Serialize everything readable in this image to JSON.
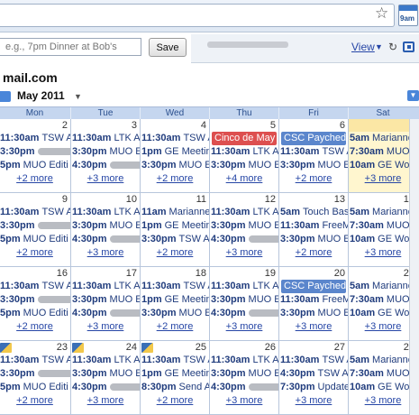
{
  "browser": {
    "extension_badge": "9am"
  },
  "popup": {
    "quick_add_placeholder": "e.g., 7pm Dinner at Bob's",
    "save_label": "Save",
    "view_label": "View",
    "account": "mail.com",
    "month_title": "May 2011"
  },
  "weekdays": [
    "Mon",
    "Tue",
    "Wed",
    "Thu",
    "Fri",
    "Sat"
  ],
  "weeks": [
    [
      {
        "num": "2",
        "events": [
          {
            "t": "11:30am",
            "x": "TSW A"
          },
          {
            "t": "3:30pm",
            "blur": true
          },
          {
            "t": "5pm",
            "x": "MUO Editi"
          }
        ],
        "more": "+2 more"
      },
      {
        "num": "3",
        "events": [
          {
            "t": "11:30am",
            "x": "LTK A"
          },
          {
            "t": "3:30pm",
            "x": "MUO Ec"
          },
          {
            "t": "4:30pm",
            "blur": true
          }
        ],
        "more": "+3 more"
      },
      {
        "num": "4",
        "events": [
          {
            "t": "11:30am",
            "x": "TSW A"
          },
          {
            "t": "1pm",
            "x": "GE Meetin"
          },
          {
            "t": "3:30pm",
            "x": "MUO Ec"
          }
        ],
        "more": "+2 more"
      },
      {
        "num": "5",
        "events": [
          {
            "allday": "red",
            "x": "Cinco de May"
          },
          {
            "t": "11:30am",
            "x": "LTK A"
          },
          {
            "t": "3:30pm",
            "x": "MUO Ec"
          }
        ],
        "more": "+4 more"
      },
      {
        "num": "6",
        "events": [
          {
            "allday": "blue",
            "x": "CSC Payched"
          },
          {
            "t": "11:30am",
            "x": "TSW A"
          },
          {
            "t": "3:30pm",
            "x": "MUO Ec"
          }
        ],
        "more": "+2 more"
      },
      {
        "num": "7",
        "today": true,
        "events": [
          {
            "t": "5am",
            "x": "Marianne"
          },
          {
            "t": "7:30am",
            "x": "MUO An"
          },
          {
            "t": "10am",
            "x": "GE Work"
          }
        ],
        "more": "+3 more"
      }
    ],
    [
      {
        "num": "9",
        "events": [
          {
            "t": "11:30am",
            "x": "TSW A"
          },
          {
            "t": "3:30pm",
            "blur": true
          },
          {
            "t": "5pm",
            "x": "MUO Editi"
          }
        ],
        "more": "+2 more"
      },
      {
        "num": "10",
        "events": [
          {
            "t": "11:30am",
            "x": "LTK A"
          },
          {
            "t": "3:30pm",
            "x": "MUO Ec"
          },
          {
            "t": "4:30pm",
            "blur": true
          }
        ],
        "more": "+3 more"
      },
      {
        "num": "11",
        "events": [
          {
            "t": "11am",
            "x": "Marianne"
          },
          {
            "t": "1pm",
            "x": "GE Meetin"
          },
          {
            "t": "3:30pm",
            "x": "TSW A"
          }
        ],
        "more": "+2 more"
      },
      {
        "num": "12",
        "events": [
          {
            "t": "11:30am",
            "x": "LTK A"
          },
          {
            "t": "3:30pm",
            "x": "MUO Ec"
          },
          {
            "t": "4:30pm",
            "blur": true
          }
        ],
        "more": "+3 more"
      },
      {
        "num": "13",
        "events": [
          {
            "t": "5am",
            "x": "Touch Bas"
          },
          {
            "t": "11:30am",
            "x": "FreeM"
          },
          {
            "t": "3:30pm",
            "x": "MUO Ec"
          }
        ],
        "more": "+2 more"
      },
      {
        "num": "14",
        "events": [
          {
            "t": "5am",
            "x": "Marianne"
          },
          {
            "t": "7:30am",
            "x": "MUO An"
          },
          {
            "t": "10am",
            "x": "GE Work"
          }
        ],
        "more": "+3 more"
      }
    ],
    [
      {
        "num": "16",
        "events": [
          {
            "t": "11:30am",
            "x": "TSW A"
          },
          {
            "t": "3:30pm",
            "blur": true
          },
          {
            "t": "5pm",
            "x": "MUO Editi"
          }
        ],
        "more": "+2 more"
      },
      {
        "num": "17",
        "events": [
          {
            "t": "11:30am",
            "x": "LTK A"
          },
          {
            "t": "3:30pm",
            "x": "MUO Ec"
          },
          {
            "t": "4:30pm",
            "blur": true
          }
        ],
        "more": "+3 more"
      },
      {
        "num": "18",
        "events": [
          {
            "t": "11:30am",
            "x": "TSW A"
          },
          {
            "t": "1pm",
            "x": "GE Meetin"
          },
          {
            "t": "3:30pm",
            "x": "MUO Ec"
          }
        ],
        "more": "+2 more"
      },
      {
        "num": "19",
        "events": [
          {
            "t": "11:30am",
            "x": "LTK A"
          },
          {
            "t": "3:30pm",
            "x": "MUO Ec"
          },
          {
            "t": "4:30pm",
            "blur": true
          }
        ],
        "more": "+3 more"
      },
      {
        "num": "20",
        "events": [
          {
            "allday": "blue",
            "x": "CSC Payched"
          },
          {
            "t": "11:30am",
            "x": "FreeM"
          },
          {
            "t": "3:30pm",
            "x": "MUO Ec"
          }
        ],
        "more": "+3 more"
      },
      {
        "num": "21",
        "events": [
          {
            "t": "5am",
            "x": "Marianne"
          },
          {
            "t": "7:30am",
            "x": "MUO An"
          },
          {
            "t": "10am",
            "x": "GE Work"
          }
        ],
        "more": "+3 more"
      }
    ],
    [
      {
        "num": "23",
        "icon": true,
        "events": [
          {
            "t": "11:30am",
            "x": "TSW A"
          },
          {
            "t": "3:30pm",
            "blur": true
          },
          {
            "t": "5pm",
            "x": "MUO Editi"
          }
        ],
        "more": "+2 more"
      },
      {
        "num": "24",
        "icon": true,
        "events": [
          {
            "t": "11:30am",
            "x": "LTK A"
          },
          {
            "t": "3:30pm",
            "x": "MUO Ec"
          },
          {
            "t": "4:30pm",
            "blur": true
          }
        ],
        "more": "+3 more"
      },
      {
        "num": "25",
        "icon": true,
        "events": [
          {
            "t": "11:30am",
            "x": "TSW A"
          },
          {
            "t": "1pm",
            "x": "GE Meetin"
          },
          {
            "t": "8:30pm",
            "x": "Send Ann"
          }
        ],
        "more": "+2 more"
      },
      {
        "num": "26",
        "events": [
          {
            "t": "11:30am",
            "x": "LTK A"
          },
          {
            "t": "3:30pm",
            "x": "MUO Ec"
          },
          {
            "t": "4:30pm",
            "blur": true
          }
        ],
        "more": "+3 more"
      },
      {
        "num": "27",
        "events": [
          {
            "t": "11:30am",
            "x": "TSW A"
          },
          {
            "t": "4:30pm",
            "x": "TSW A"
          },
          {
            "t": "7:30pm",
            "x": "Update"
          }
        ],
        "more": "+3 more"
      },
      {
        "num": "28",
        "events": [
          {
            "t": "5am",
            "x": "Marianne"
          },
          {
            "t": "7:30am",
            "x": "MUO An"
          },
          {
            "t": "10am",
            "x": "GE Work"
          }
        ],
        "more": "+3 more"
      }
    ]
  ]
}
